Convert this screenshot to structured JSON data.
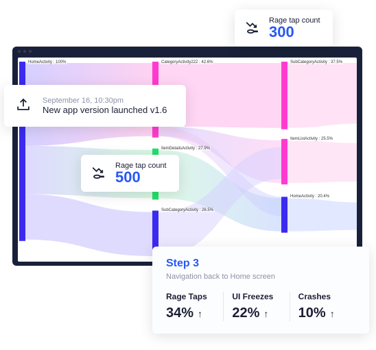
{
  "chart_data": {
    "type": "sankey",
    "columns": [
      {
        "nodes": [
          {
            "name": "HomeActivity",
            "pct": 100,
            "color": "#3b2af0"
          }
        ]
      },
      {
        "nodes": [
          {
            "name": "CategoryActivity222",
            "pct": 42.6,
            "color": "#ff3bcf"
          },
          {
            "name": "ItemDetailsActivity",
            "pct": 27.9,
            "color": "#22e06b"
          },
          {
            "name": "SubCategoryActivity",
            "pct": 26.5,
            "color": "#3b2af0"
          }
        ]
      },
      {
        "nodes": [
          {
            "name": "SubCategoryActivity",
            "pct": 37.5,
            "color": "#ff3bcf"
          },
          {
            "name": "ItemListActivity",
            "pct": 25.5,
            "color": "#ff3bcf"
          },
          {
            "name": "HomeActivity",
            "pct": 20.4,
            "color": "#3b2af0"
          }
        ]
      }
    ]
  },
  "cards": {
    "rage1": {
      "label": "Rage tap count",
      "value": "300"
    },
    "rage2": {
      "label": "Rage tap count",
      "value": "500"
    },
    "upload": {
      "ts": "September 16, 10:30pm",
      "msg": "New app version launched v1.6"
    },
    "step": {
      "title": "Step 3",
      "subtitle": "Navigation back to Home screen",
      "metrics": [
        {
          "label": "Rage Taps",
          "value": "34%"
        },
        {
          "label": "UI Freezes",
          "value": "22%"
        },
        {
          "label": "Crashes",
          "value": "10%"
        }
      ]
    }
  }
}
